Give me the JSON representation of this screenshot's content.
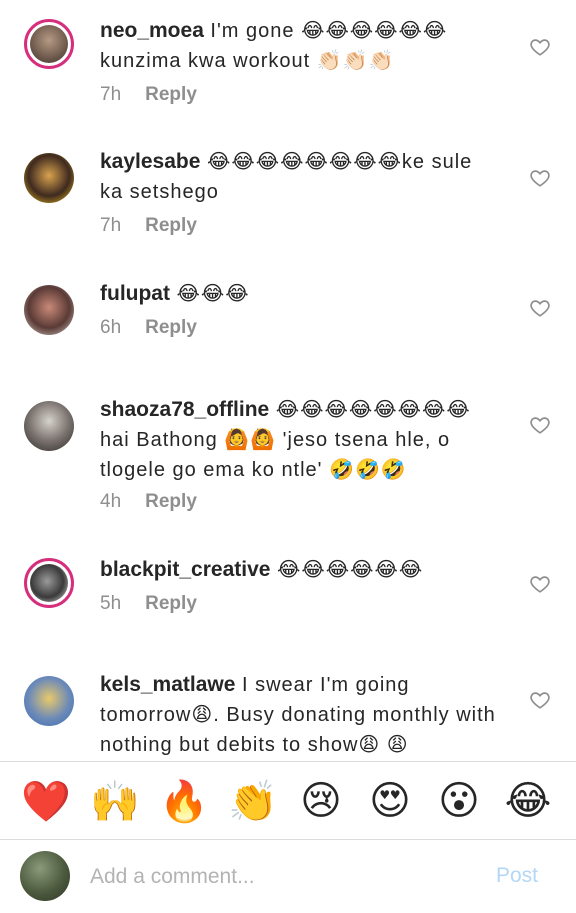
{
  "comments": [
    {
      "username": "neo_moea",
      "body": " I'm gone 😂😂😂😂😂😂 kunzima kwa workout 👏🏻👏🏻👏🏻",
      "time": "7h",
      "reply": "Reply",
      "avatar_story_ring": true
    },
    {
      "username": "kaylesabe",
      "body": " 😂😂😂😂😂😂😂😂ke sule ka setshego",
      "time": "7h",
      "reply": "Reply",
      "avatar_story_ring": false
    },
    {
      "username": "fulupat",
      "body": " 😂😂😂",
      "time": "6h",
      "reply": "Reply",
      "avatar_story_ring": false
    },
    {
      "username": "shaoza78_offline",
      "body": " 😂😂😂😂😂😂😂😂 hai Bathong 🙆🙆 'jeso tsena hle, o tlogele go ema ko ntle' 🤣🤣🤣",
      "time": "4h",
      "reply": "Reply",
      "avatar_story_ring": false
    },
    {
      "username": "blackpit_creative",
      "body": " 😂😂😂😂😂😂",
      "time": "5h",
      "reply": "Reply",
      "avatar_story_ring": true
    },
    {
      "username": "kels_matlawe",
      "body": " I swear I'm going tomorrow😩. Busy donating monthly with nothing but debits to show😩 😩",
      "time": "",
      "reply": "",
      "avatar_story_ring": false
    }
  ],
  "reactions": [
    "❤️",
    "🙌",
    "🔥",
    "👏",
    "😢",
    "😍",
    "😮",
    "😂"
  ],
  "composer": {
    "placeholder": "Add a comment...",
    "post_label": "Post"
  },
  "colors": {
    "story_ring": "#d62e7c",
    "muted_text": "#8e8e8e",
    "post_disabled": "#b3d7f6",
    "divider": "#dbdbdb"
  }
}
